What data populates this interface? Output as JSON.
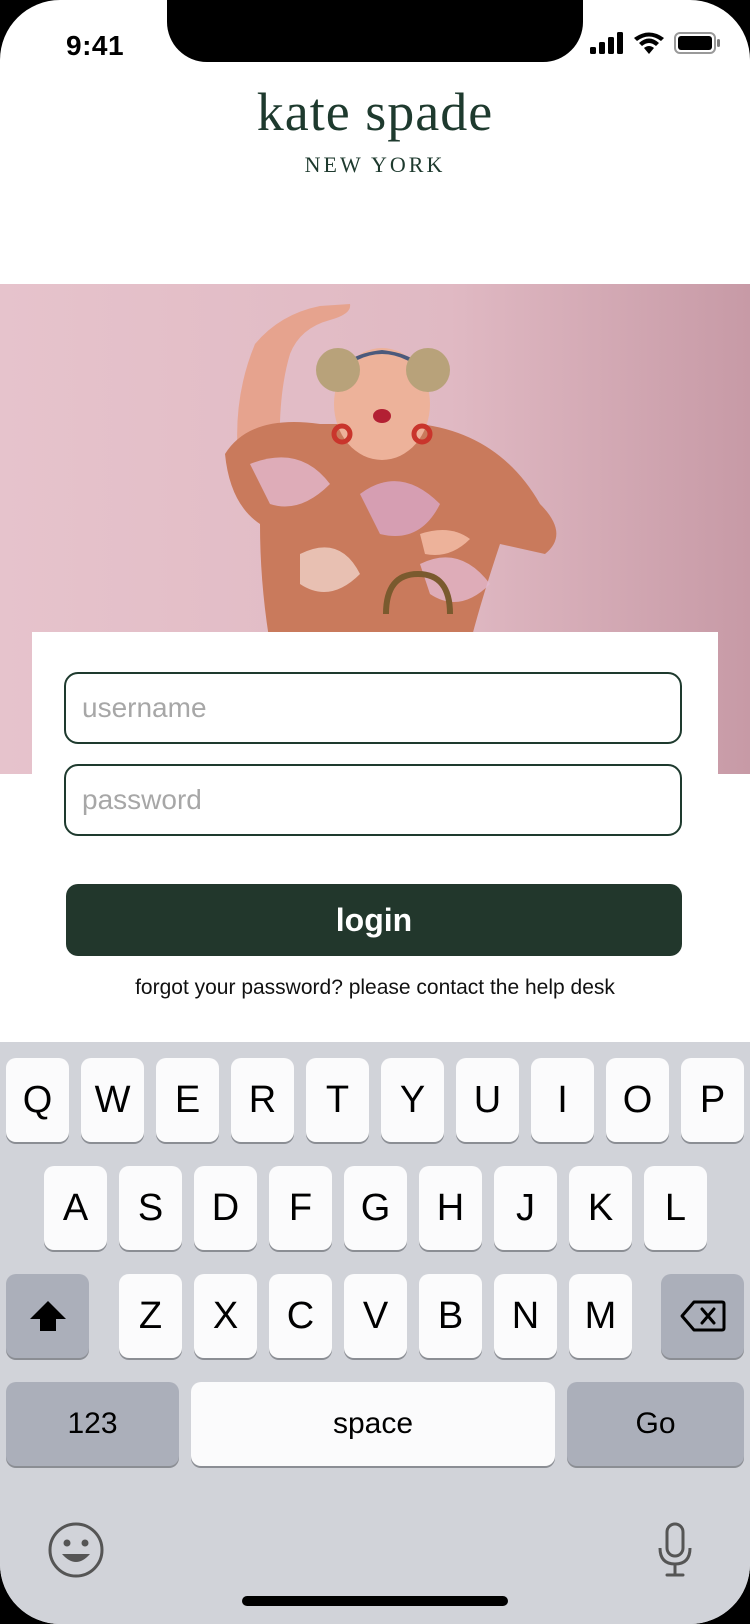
{
  "status_bar": {
    "time": "9:41"
  },
  "brand": {
    "name": "kate spade",
    "sub": "NEW YORK"
  },
  "form": {
    "username_placeholder": "username",
    "password_placeholder": "password",
    "login_label": "login",
    "forgot_text": "forgot your password? please contact the help desk"
  },
  "keyboard": {
    "row1": [
      "Q",
      "W",
      "E",
      "R",
      "T",
      "Y",
      "U",
      "I",
      "O",
      "P"
    ],
    "row2": [
      "A",
      "S",
      "D",
      "F",
      "G",
      "H",
      "J",
      "K",
      "L"
    ],
    "row3": [
      "Z",
      "X",
      "C",
      "V",
      "B",
      "N",
      "M"
    ],
    "numbers_label": "123",
    "space_label": "space",
    "go_label": "Go"
  },
  "icons": [
    "signal-icon",
    "wifi-icon",
    "battery-icon",
    "shift-icon",
    "backspace-icon",
    "emoji-icon",
    "microphone-icon"
  ],
  "colors": {
    "brand_green": "#22372c",
    "hero_pink": "#e6c3cc",
    "keyboard_bg": "#d1d3d9"
  }
}
